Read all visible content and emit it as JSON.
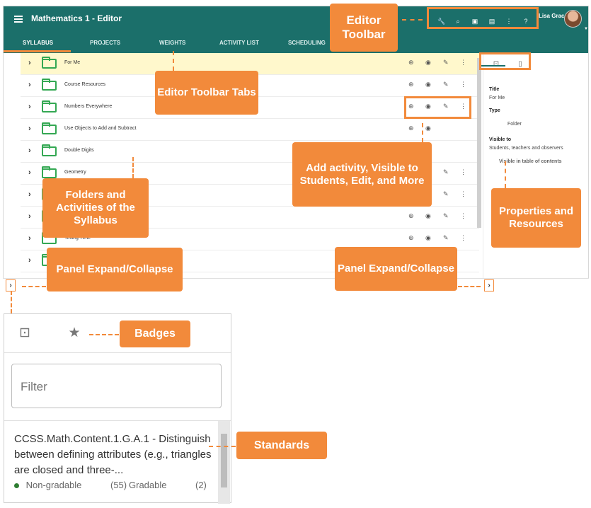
{
  "app": {
    "title": "Mathematics 1 - Editor",
    "user_name": "Lisa Grace"
  },
  "tabs": [
    "SYLLABUS",
    "PROJECTS",
    "WEIGHTS",
    "ACTIVITY LIST",
    "SCHEDULING"
  ],
  "toolbar_icons": [
    "wrench-icon",
    "search-icon",
    "clipboard-icon",
    "message-icon",
    "apps-icon",
    "help-icon"
  ],
  "syllabus_rows": [
    {
      "label": "For Me",
      "highlighted": true
    },
    {
      "label": "Course Resources",
      "highlighted": false
    },
    {
      "label": "Numbers Everywhere",
      "highlighted": false
    },
    {
      "label": "Use Objects to Add and Subtract",
      "highlighted": false
    },
    {
      "label": "Double Digits",
      "highlighted": false
    },
    {
      "label": "Geometry",
      "highlighted": false
    },
    {
      "label": "",
      "highlighted": false
    },
    {
      "label": "",
      "highlighted": false
    },
    {
      "label": "Telling Time",
      "highlighted": false
    },
    {
      "label": "",
      "highlighted": false
    }
  ],
  "properties": {
    "title_label": "Title",
    "title_value": "For Me",
    "type_label": "Type",
    "type_value": "Folder",
    "visible_label": "Visible to",
    "visible_value": "Students, teachers and observers",
    "toc_label": "Visible in table of contents"
  },
  "callouts": {
    "editor_toolbar": "Editor Toolbar",
    "editor_toolbar_tabs": "Editor Toolbar Tabs",
    "folders_and_activities": "Folders and Activities of the Syllabus",
    "add_activity": "Add activity, Visible to Students, Edit, and More",
    "properties_resources": "Properties and Resources",
    "panel_left": "Panel Expand/Collapse",
    "panel_right": "Panel Expand/Collapse",
    "badges": "Badges",
    "standards": "Standards"
  },
  "standards_panel": {
    "filter_placeholder": "Filter",
    "standard_text": "CCSS.Math.Content.1.G.A.1 - Distinguish between defining attributes (e.g., triangles are closed and three-...",
    "non_gradable_label": "Non-gradable",
    "non_gradable_count": "(55)",
    "gradable_label": "Gradable",
    "gradable_count": "(2)"
  },
  "colors": {
    "header": "#1b6f6a",
    "accent": "#f28a3b",
    "folder": "#34a853"
  }
}
